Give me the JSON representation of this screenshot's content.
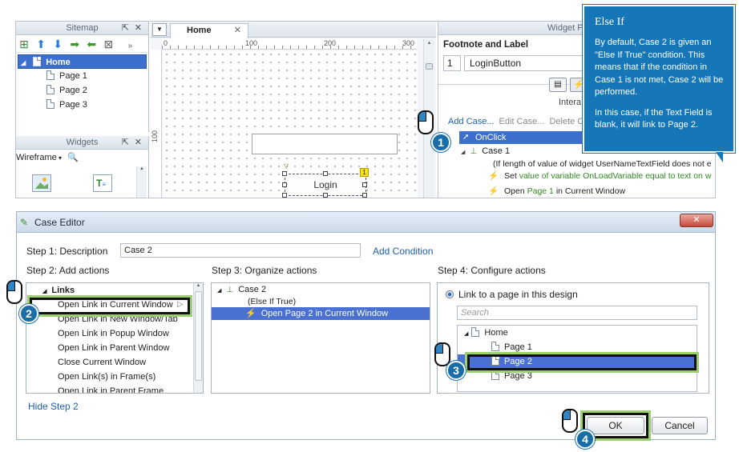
{
  "sitemap": {
    "title": "Sitemap",
    "tree": [
      {
        "label": "Home",
        "selected": true
      },
      {
        "label": "Page 1"
      },
      {
        "label": "Page 2"
      },
      {
        "label": "Page 3"
      }
    ]
  },
  "widgets": {
    "title": "Widgets",
    "library": "Wireframe"
  },
  "canvas": {
    "tab": "Home",
    "ruler_marks": [
      "0",
      "100",
      "200",
      "300"
    ],
    "vruler_mark": "100",
    "button_label": "Login",
    "badge": "1"
  },
  "props": {
    "title": "Widget P",
    "section": "Footnote and Label",
    "footnote": "1",
    "label": "LoginButton",
    "tab_text": "Intera",
    "actions": [
      "Add Case...",
      "Edit Case...",
      "Delete Ca"
    ],
    "event": "OnClick",
    "case": "Case 1",
    "condition": "(If length of value of widget UserNameTextField does not e",
    "set_prefix": "Set",
    "set_detail": "value of variable OnLoadVariable equal to text on w",
    "open_prefix": "Open",
    "open_page": "Page 1",
    "open_suffix": "in Current Window"
  },
  "callout": {
    "title": "Else If",
    "p1": "By default, Case 2 is given an \"Else If True\" condition. This means that if the condition in Case 1 is not met, Case 2 will be performed.",
    "p2": "In this case, if the Text Field is blank, it will link to Page 2."
  },
  "dialog": {
    "title": "Case Editor",
    "step1_label": "Step 1: Description",
    "description": "Case 2",
    "add_condition": "Add Condition",
    "step2": "Step 2: Add actions",
    "step3": "Step 3: Organize actions",
    "step4": "Step 4: Configure actions",
    "group": "Links",
    "actions": [
      "Open Link in Current Window",
      "Open Link in New Window/Tab",
      "Open Link in Popup Window",
      "Open Link in Parent Window",
      "Close Current Window",
      "Open Link(s) in Frame(s)",
      "Open Link in Parent Frame"
    ],
    "organize_case": "Case 2",
    "organize_cond": "(Else If True)",
    "organize_action": "Open Page 2 in Current Window",
    "radio_label": "Link to a page in this design",
    "search_placeholder": "Search",
    "pages": [
      "Home",
      "Page 1",
      "Page 2",
      "Page 3"
    ],
    "hide_step": "Hide Step 2",
    "ok": "OK",
    "cancel": "Cancel"
  },
  "steps": [
    "1",
    "2",
    "3",
    "4"
  ],
  "colors": {
    "callout_bg": "#1576b8",
    "selection": "#4a71d1",
    "highlight_ring": "#9ccf6f",
    "link": "#1f5fa8"
  }
}
